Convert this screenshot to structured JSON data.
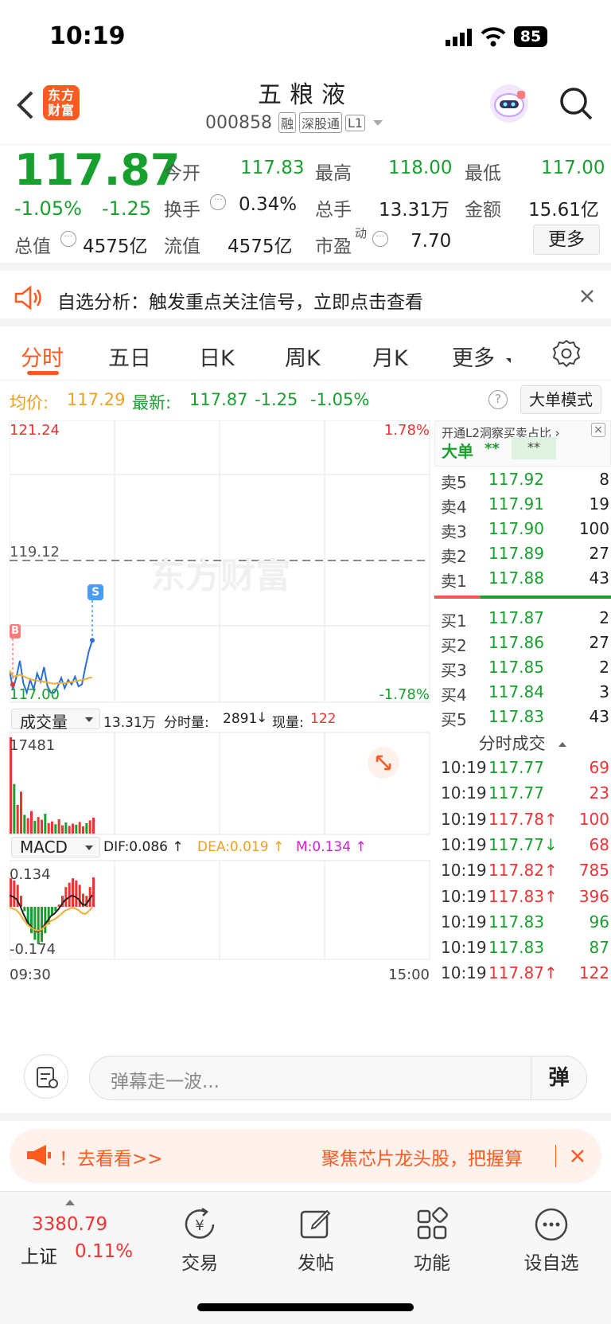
{
  "status": {
    "time": "10:19",
    "battery": "85"
  },
  "header": {
    "title": "五粮液",
    "code": "000858",
    "tags": [
      "融",
      "深股通",
      "L1"
    ],
    "logo_text": "东方财富"
  },
  "quote": {
    "price": "117.87",
    "pct": "-1.05%",
    "chg": "-1.25",
    "fields": [
      {
        "label": "今开",
        "value": "117.83"
      },
      {
        "label": "最高",
        "value": "118.00"
      },
      {
        "label": "最低",
        "value": "117.00"
      },
      {
        "label": "换手",
        "value": "0.34%"
      },
      {
        "label": "总手",
        "value": "13.31万"
      },
      {
        "label": "金额",
        "value": "15.61亿"
      },
      {
        "label": "总值",
        "value": "4575亿"
      },
      {
        "label": "流值",
        "value": "4575亿"
      },
      {
        "label": "市盈",
        "value": "7.70"
      }
    ],
    "pe_sup": "动",
    "more": "更多"
  },
  "banner": {
    "text": "自选分析：触发重点关注信号，立即点击查看"
  },
  "tabs": [
    "分时",
    "五日",
    "日K",
    "周K",
    "月K",
    "更多"
  ],
  "info": {
    "avg_label": "均价:",
    "avg": "117.29",
    "latest_label": "最新:",
    "latest": "117.87",
    "chg": "-1.25",
    "pct": "-1.05%",
    "mode_btn": "大单模式",
    "help": "?"
  },
  "chart": {
    "price_top": "121.24",
    "pct_top": "1.78%",
    "ref_price": "119.12",
    "price_bottom": "117.00",
    "pct_bottom": "-1.78%",
    "watermark": "东方财富",
    "marker_b": "B",
    "marker_s": "S",
    "vol_dropdown": "成交量",
    "vol_total": "13.31万",
    "vol_tick_label": "分时量:",
    "vol_tick": "2891",
    "vol_now_label": "现量:",
    "vol_now": "122",
    "vol_max": "17481",
    "macd_dropdown": "MACD",
    "dif": "DIF:0.086 ↑",
    "dea": "DEA:0.019 ↑",
    "m": "M:0.134 ↑",
    "macd_top": "0.134",
    "macd_bottom": "-0.174",
    "time_start": "09:30",
    "time_end": "15:00"
  },
  "chart_data": {
    "type": "line",
    "title": "",
    "series": [
      {
        "name": "最新",
        "values": [
          117.4,
          117.1,
          117.3,
          117.55,
          117.2,
          117.05,
          117.25,
          117.1,
          117.35,
          117.22,
          117.45,
          117.15,
          117.05,
          117.05,
          117.15,
          117.28,
          117.12,
          117.25,
          117.18,
          117.3,
          117.15,
          117.18,
          117.45,
          117.7,
          117.87
        ]
      },
      {
        "name": "均价",
        "values": [
          117.4,
          117.3,
          117.31,
          117.33,
          117.31,
          117.28,
          117.26,
          117.25,
          117.24,
          117.23,
          117.22,
          117.21,
          117.2,
          117.19,
          117.2,
          117.2,
          117.2,
          117.21,
          117.22,
          117.23,
          117.24,
          117.25,
          117.26,
          117.28,
          117.29
        ]
      }
    ],
    "ylim": [
      117.0,
      121.24
    ],
    "ref": 119.12,
    "volumes": [
      17481,
      9000,
      5200,
      7600,
      3400,
      2800,
      4100,
      2300,
      3000,
      2500,
      3600,
      1900,
      2200,
      1700,
      2600,
      1500,
      2000,
      1400,
      1800,
      1600,
      2100,
      1300,
      1900,
      2400,
      2891
    ],
    "macd": [
      0.13,
      0.12,
      0.1,
      0.05,
      -0.02,
      -0.08,
      -0.12,
      -0.15,
      -0.17,
      -0.16,
      -0.12,
      -0.08,
      -0.04,
      -0.02,
      0.01,
      0.05,
      0.09,
      0.11,
      0.13,
      0.12,
      0.1,
      0.06,
      0.05,
      0.09,
      0.134
    ]
  },
  "orderbook": {
    "promo": "开通L2洞察买卖占比 ›",
    "big_label": "大单",
    "big_v1": "**",
    "big_v2": "**",
    "asks": [
      {
        "label": "卖5",
        "price": "117.92",
        "vol": "8"
      },
      {
        "label": "卖4",
        "price": "117.91",
        "vol": "19"
      },
      {
        "label": "卖3",
        "price": "117.90",
        "vol": "100"
      },
      {
        "label": "卖2",
        "price": "117.89",
        "vol": "27"
      },
      {
        "label": "卖1",
        "price": "117.88",
        "vol": "43"
      }
    ],
    "bids": [
      {
        "label": "买1",
        "price": "117.87",
        "vol": "2"
      },
      {
        "label": "买2",
        "price": "117.86",
        "vol": "27"
      },
      {
        "label": "买3",
        "price": "117.85",
        "vol": "2"
      },
      {
        "label": "买4",
        "price": "117.84",
        "vol": "3"
      },
      {
        "label": "买5",
        "price": "117.83",
        "vol": "43"
      }
    ],
    "ticks_title": "分时成交",
    "ticks": [
      {
        "t": "10:19",
        "p": "117.77",
        "v": "69"
      },
      {
        "t": "10:19",
        "p": "117.77",
        "v": "23"
      },
      {
        "t": "10:19",
        "p": "117.78↑",
        "v": "100"
      },
      {
        "t": "10:19",
        "p": "117.77↓",
        "v": "68"
      },
      {
        "t": "10:19",
        "p": "117.82↑",
        "v": "785"
      },
      {
        "t": "10:19",
        "p": "117.83↑",
        "v": "396"
      },
      {
        "t": "10:19",
        "p": "117.83",
        "v": "96"
      },
      {
        "t": "10:19",
        "p": "117.83",
        "v": "87"
      },
      {
        "t": "10:19",
        "p": "117.87↑",
        "v": "122"
      }
    ]
  },
  "comment": {
    "placeholder": "弹幕走一波...",
    "send": "弹"
  },
  "promo": {
    "left": "！去看看>>",
    "right": "聚焦芯片龙头股，把握算"
  },
  "bottom": {
    "index_value": "3380.79",
    "index_name": "上证",
    "index_pct": "0.11%",
    "items": [
      "交易",
      "发帖",
      "功能",
      "设自选"
    ]
  },
  "colors": {
    "up": "#e33333",
    "down": "#18a02e",
    "brand": "#ff5a1f",
    "avg": "#f0a020"
  }
}
